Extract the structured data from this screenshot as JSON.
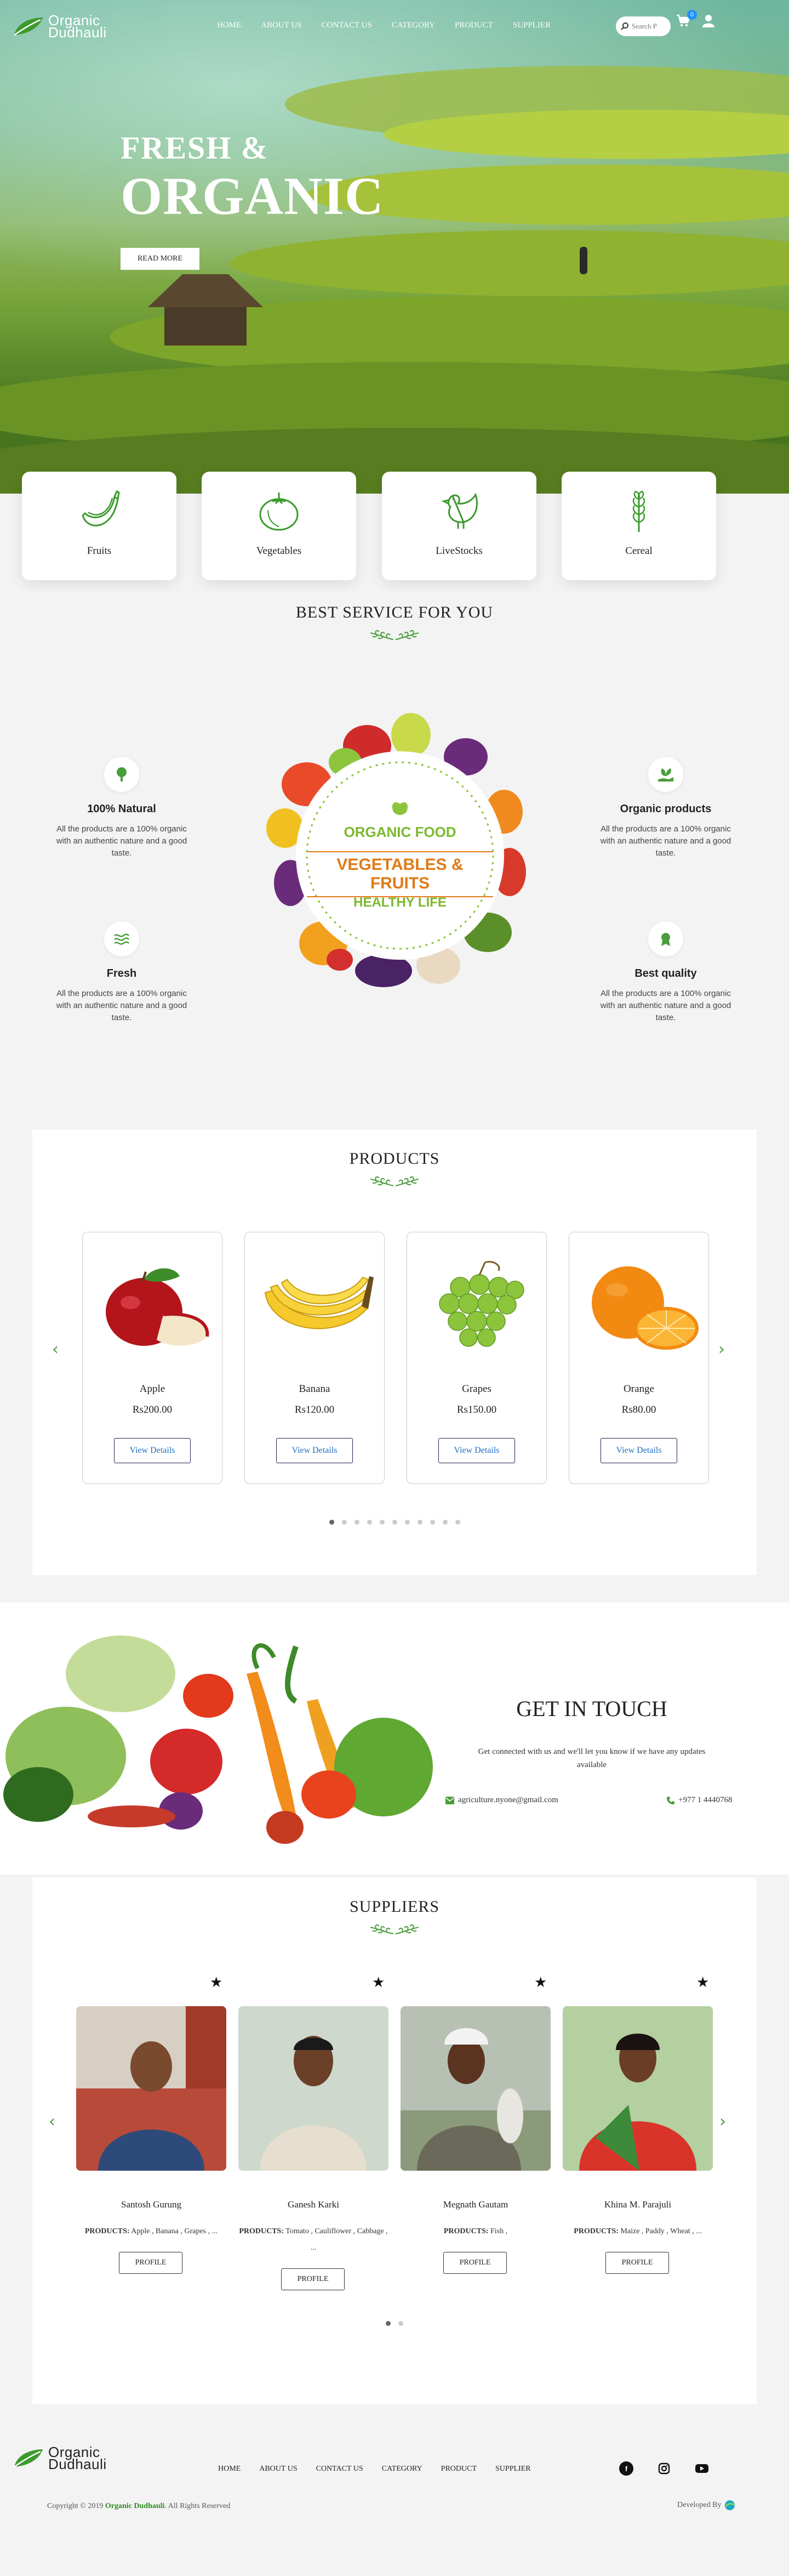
{
  "brand": {
    "line1": "Organic",
    "line2": "Dudhauli"
  },
  "nav": [
    "HOME",
    "ABOUT US",
    "CONTACT US",
    "CATEGORY",
    "PRODUCT",
    "SUPPLIER"
  ],
  "search": {
    "placeholder": "Search P"
  },
  "cart": {
    "count": "0"
  },
  "hero": {
    "line1": "FRESH &",
    "line2": "ORGANIC",
    "button": "READ MORE"
  },
  "categories": [
    {
      "label": "Fruits",
      "icon": "banana-icon"
    },
    {
      "label": "Vegetables",
      "icon": "tomato-icon"
    },
    {
      "label": "LiveStocks",
      "icon": "chicken-icon"
    },
    {
      "label": "Cereal",
      "icon": "wheat-icon"
    }
  ],
  "service": {
    "title": "BEST SERVICE FOR YOU",
    "plate": {
      "top": "ORGANIC FOOD",
      "middle": "VEGETABLES & FRUITS",
      "bottom": "HEALTHY LIFE"
    },
    "features": [
      {
        "title": "100% Natural",
        "desc": "All the products are a 100% organic with an authentic nature and a good taste."
      },
      {
        "title": "Organic products",
        "desc": "All the products are a 100% organic with an authentic nature and a good taste."
      },
      {
        "title": "Fresh",
        "desc": "All the products are a 100% organic with an authentic nature and a good taste."
      },
      {
        "title": "Best quality",
        "desc": "All the products are a 100% organic with an authentic nature and a good taste."
      }
    ]
  },
  "products": {
    "title": "PRODUCTS",
    "button": "View Details",
    "items": [
      {
        "name": "Apple",
        "price": "Rs200.00"
      },
      {
        "name": "Banana",
        "price": "Rs120.00"
      },
      {
        "name": "Grapes",
        "price": "Rs150.00"
      },
      {
        "name": "Orange",
        "price": "Rs80.00"
      }
    ],
    "pages": 11,
    "active_page": 1
  },
  "contact": {
    "title": "GET IN TOUCH",
    "subtitle": "Get connected with us and we'll let you know if we have any updates available",
    "email": "agriculture.nyone@gmail.com",
    "phone": "+977 1 4440768"
  },
  "suppliers": {
    "title": "SUPPLIERS",
    "products_label": "PRODUCTS:",
    "button": "PROFILE",
    "items": [
      {
        "name": "Santosh Gurung",
        "products": "Apple , Banana , Grapes , ..."
      },
      {
        "name": "Ganesh Karki",
        "products": "Tomato , Cauliflower , Cabbage , ..."
      },
      {
        "name": "Megnath Gautam",
        "products": "Fish ,"
      },
      {
        "name": "Khina M. Parajuli",
        "products": "Maize , Paddy , Wheat , ..."
      }
    ],
    "pages": 2,
    "active_page": 1
  },
  "footer": {
    "nav": [
      "HOME",
      "ABOUT US",
      "CONTACT US",
      "CATEGORY",
      "PRODUCT",
      "SUPPLIER"
    ],
    "social": [
      "facebook-icon",
      "instagram-icon",
      "youtube-icon"
    ],
    "copyright_prefix": "Copyright © 2019",
    "copyright_brand": "Organic Dudhauli",
    "copyright_suffix": ". All Rights Reserved",
    "developed_by": "Developed By"
  },
  "colors": {
    "accent": "#4a9d3c",
    "link": "#1e6fc4",
    "brand_green": "#2e8b22"
  }
}
